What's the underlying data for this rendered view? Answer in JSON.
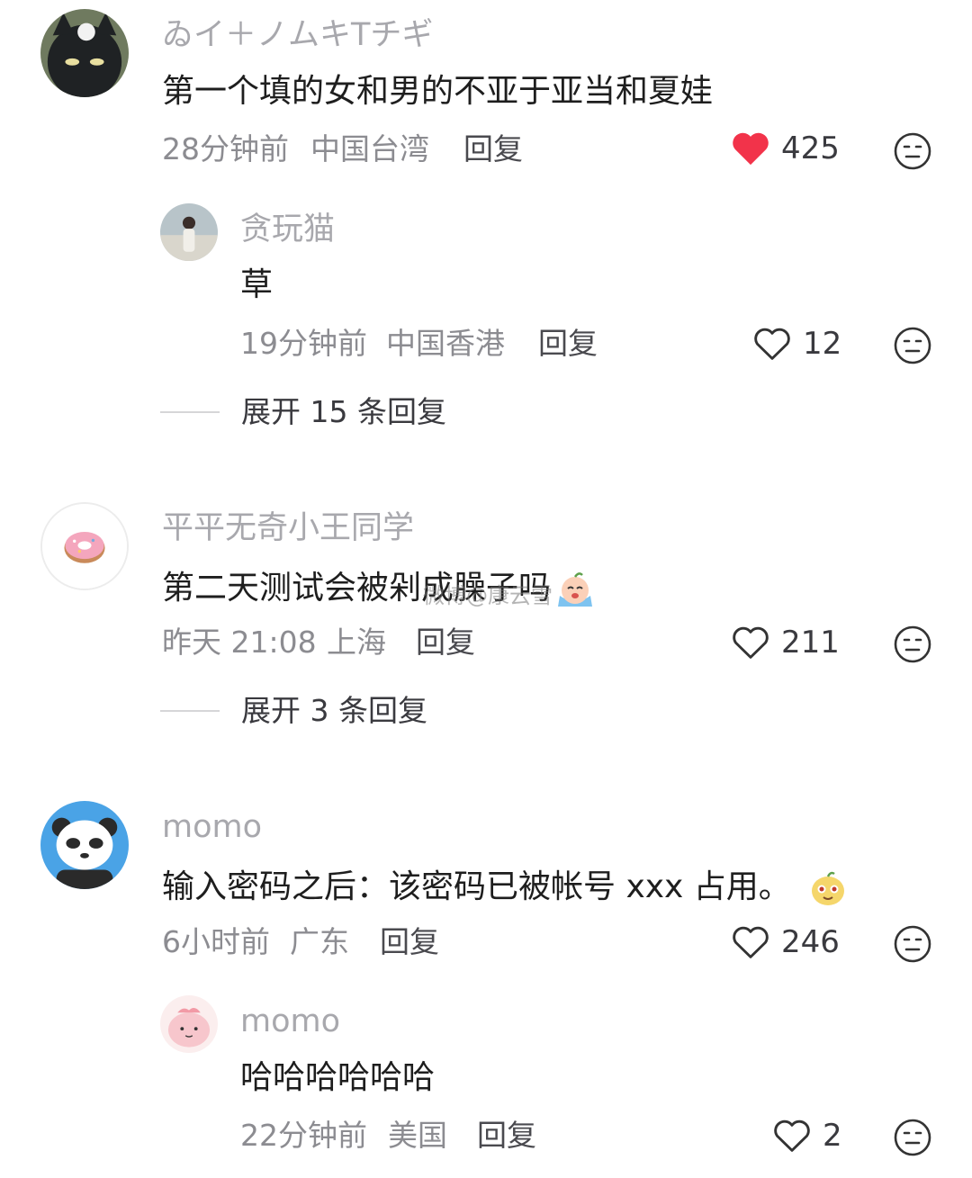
{
  "comments": [
    {
      "username": "ゐイ＋ノムキTチギ",
      "avatar": "black-cat-avatar",
      "content": "第一个填的女和男的不亚于亚当和夏娃",
      "time": "28分钟前",
      "location": "中国台湾",
      "reply_label": "回复",
      "likes": "425",
      "liked": true,
      "replies": [
        {
          "username": "贪玩猫",
          "avatar": "girl-photo-avatar",
          "content": "草",
          "time": "19分钟前",
          "location": "中国香港",
          "reply_label": "回复",
          "likes": "12",
          "liked": false
        }
      ],
      "expand_label": "展开 15 条回复"
    },
    {
      "username": "平平无奇小王同学",
      "avatar": "donut-avatar",
      "content": "第二天测试会被剁成臊子吗",
      "content_emoji": "crying-emoji",
      "time": "昨天 21:08",
      "location": "上海",
      "reply_label": "回复",
      "likes": "211",
      "liked": false,
      "expand_label": "展开 3 条回复"
    },
    {
      "username": "momo",
      "avatar": "panda-avatar",
      "content": "输入密码之后：该密码已被帐号 xxx 占用。",
      "content_emoji": "smirk-emoji",
      "time": "6小时前",
      "location": "广东",
      "reply_label": "回复",
      "likes": "246",
      "liked": false,
      "replies": [
        {
          "username": "momo",
          "avatar": "pink-blob-avatar",
          "content": "哈哈哈哈哈哈",
          "time": "22分钟前",
          "location": "美国",
          "reply_label": "回复",
          "likes": "2",
          "liked": false
        }
      ]
    }
  ],
  "watermark": "微博@康云雪",
  "colors": {
    "like_active": "#f2334a",
    "text_secondary": "#8c8c91"
  }
}
